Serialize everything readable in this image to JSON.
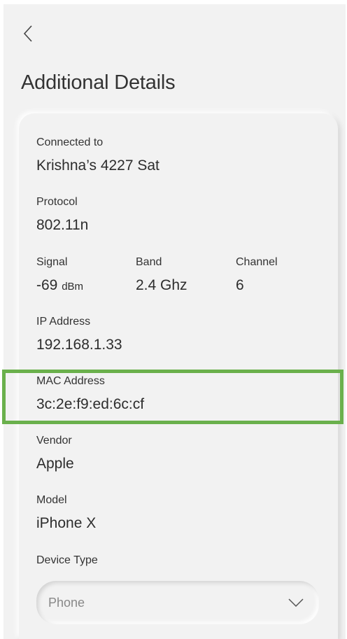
{
  "header": {
    "title": "Additional Details"
  },
  "details": {
    "connected_to": {
      "label": "Connected to",
      "value": "Krishna’s 4227 Sat"
    },
    "protocol": {
      "label": "Protocol",
      "value": "802.11n"
    },
    "signal": {
      "label": "Signal",
      "value": "-69",
      "unit": "dBm"
    },
    "band": {
      "label": "Band",
      "value": "2.4 Ghz"
    },
    "channel": {
      "label": "Channel",
      "value": "6"
    },
    "ip": {
      "label": "IP Address",
      "value": "192.168.1.33"
    },
    "mac": {
      "label": "MAC Address",
      "value": "3c:2e:f9:ed:6c:cf"
    },
    "vendor": {
      "label": "Vendor",
      "value": "Apple"
    },
    "model": {
      "label": "Model",
      "value": "iPhone X"
    },
    "device_type": {
      "label": "Device Type",
      "selected": "Phone"
    }
  },
  "colors": {
    "highlight": "#6ab04c",
    "background": "#f2f2f2"
  },
  "icons": {
    "back": "chevron-left-icon",
    "dropdown": "chevron-down-icon"
  }
}
